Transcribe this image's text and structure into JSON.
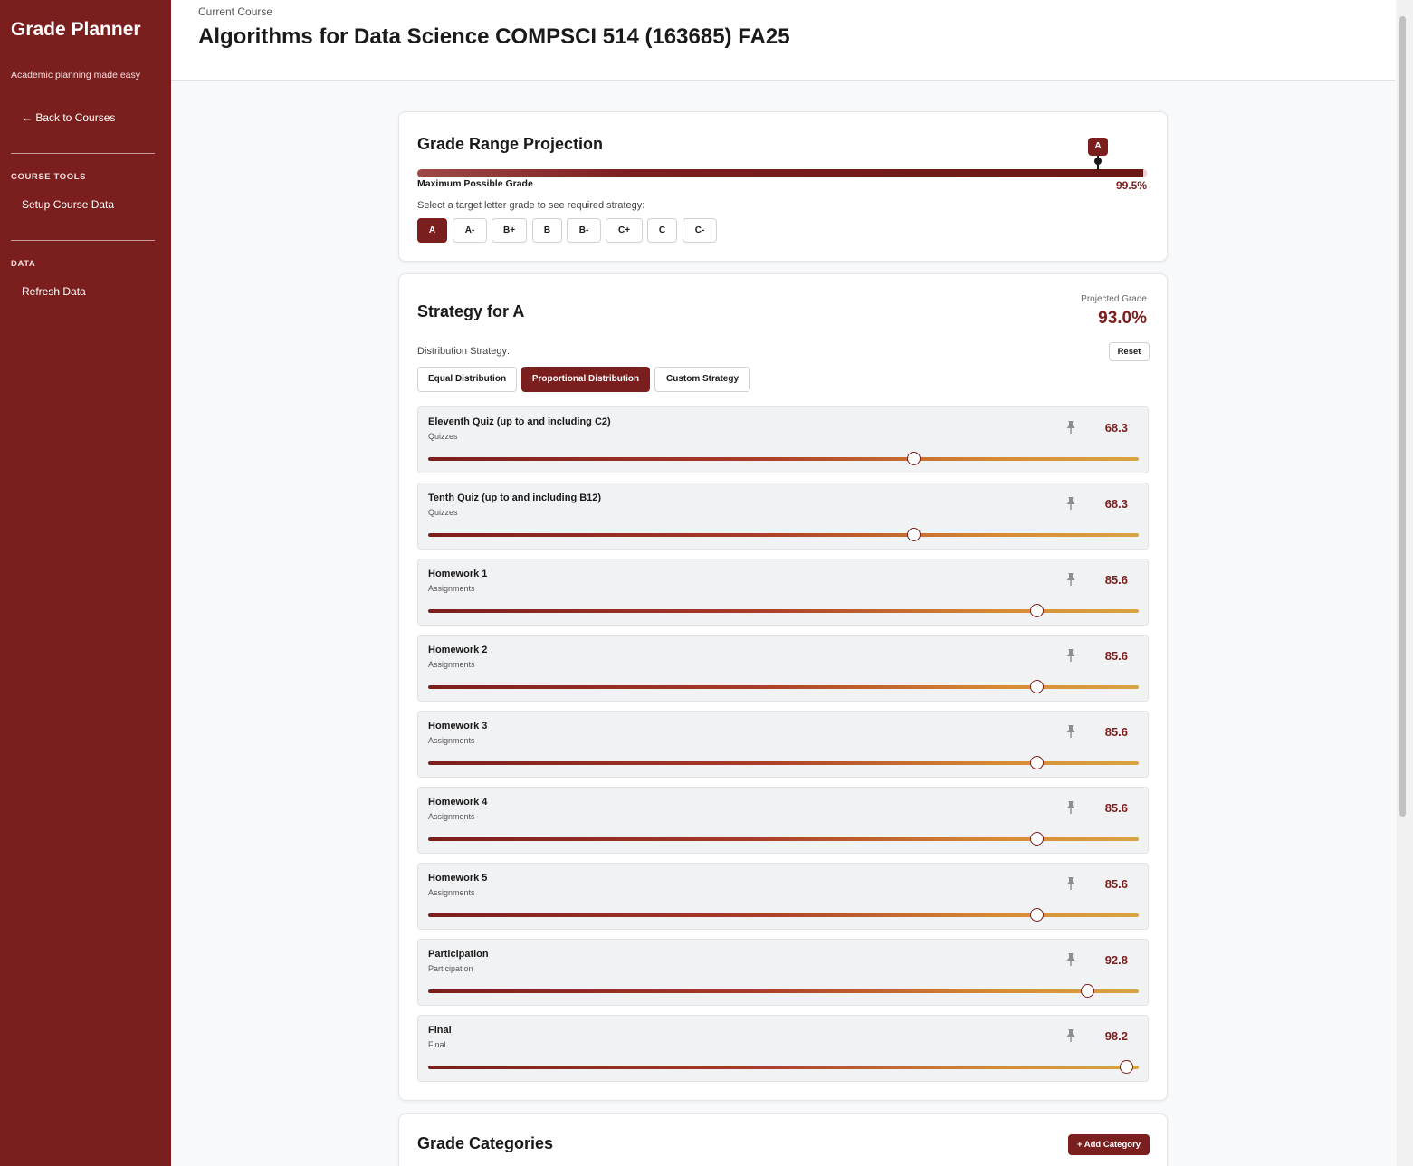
{
  "sidebar": {
    "brand": "Grade Planner",
    "tagline": "Academic planning made easy",
    "back_label": "← Back to Courses",
    "sections": [
      {
        "label": "COURSE TOOLS",
        "items": [
          "Setup Course Data"
        ]
      },
      {
        "label": "DATA",
        "items": [
          "Refresh Data"
        ]
      }
    ]
  },
  "header": {
    "course_label": "Current Course",
    "course_title": "Algorithms for Data Science COMPSCI 514 (163685) FA25"
  },
  "projection": {
    "title": "Grade Range Projection",
    "marker_label": "A",
    "max_label": "Maximum Possible Grade",
    "max_value": "99.5%",
    "select_hint": "Select a target letter grade to see required strategy:",
    "grades": [
      "A",
      "A-",
      "B+",
      "B",
      "B-",
      "C+",
      "C",
      "C-"
    ],
    "selected_grade": "A"
  },
  "strategy": {
    "title": "Strategy for A",
    "projected_label": "Projected Grade",
    "projected_value": "93.0%",
    "dist_label": "Distribution Strategy:",
    "reset_label": "Reset",
    "options": [
      "Equal Distribution",
      "Proportional Distribution",
      "Custom Strategy"
    ],
    "selected_option": "Proportional Distribution",
    "items": [
      {
        "name": "Eleventh Quiz (up to and including C2)",
        "category": "Quizzes",
        "value": "68.3",
        "score": 68.3
      },
      {
        "name": "Tenth Quiz (up to and including B12)",
        "category": "Quizzes",
        "value": "68.3",
        "score": 68.3
      },
      {
        "name": "Homework 1",
        "category": "Assignments",
        "value": "85.6",
        "score": 85.6
      },
      {
        "name": "Homework 2",
        "category": "Assignments",
        "value": "85.6",
        "score": 85.6
      },
      {
        "name": "Homework 3",
        "category": "Assignments",
        "value": "85.6",
        "score": 85.6
      },
      {
        "name": "Homework 4",
        "category": "Assignments",
        "value": "85.6",
        "score": 85.6
      },
      {
        "name": "Homework 5",
        "category": "Assignments",
        "value": "85.6",
        "score": 85.6
      },
      {
        "name": "Participation",
        "category": "Participation",
        "value": "92.8",
        "score": 92.8
      },
      {
        "name": "Final",
        "category": "Final",
        "value": "98.2",
        "score": 98.2
      }
    ]
  },
  "categories": {
    "title": "Grade Categories",
    "add_label": "+ Add Category"
  },
  "icons": {
    "pin": "pin-icon"
  },
  "colors": {
    "accent": "#7b1e1e",
    "slider_end": "#d9a441"
  }
}
